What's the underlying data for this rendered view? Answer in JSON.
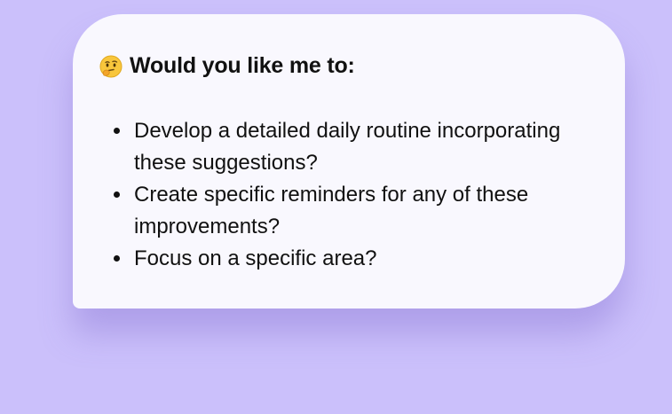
{
  "prompt": {
    "emoji_icon": "thinking-face-icon",
    "heading": "Would you like me to:",
    "options": [
      "Develop a detailed daily routine incorporating these suggestions?",
      "Create specific reminders for any of these improvements?",
      "Focus on a specific area?"
    ]
  },
  "colors": {
    "background": "#cbc0fb",
    "card": "#f9f8fe",
    "text": "#111111"
  }
}
